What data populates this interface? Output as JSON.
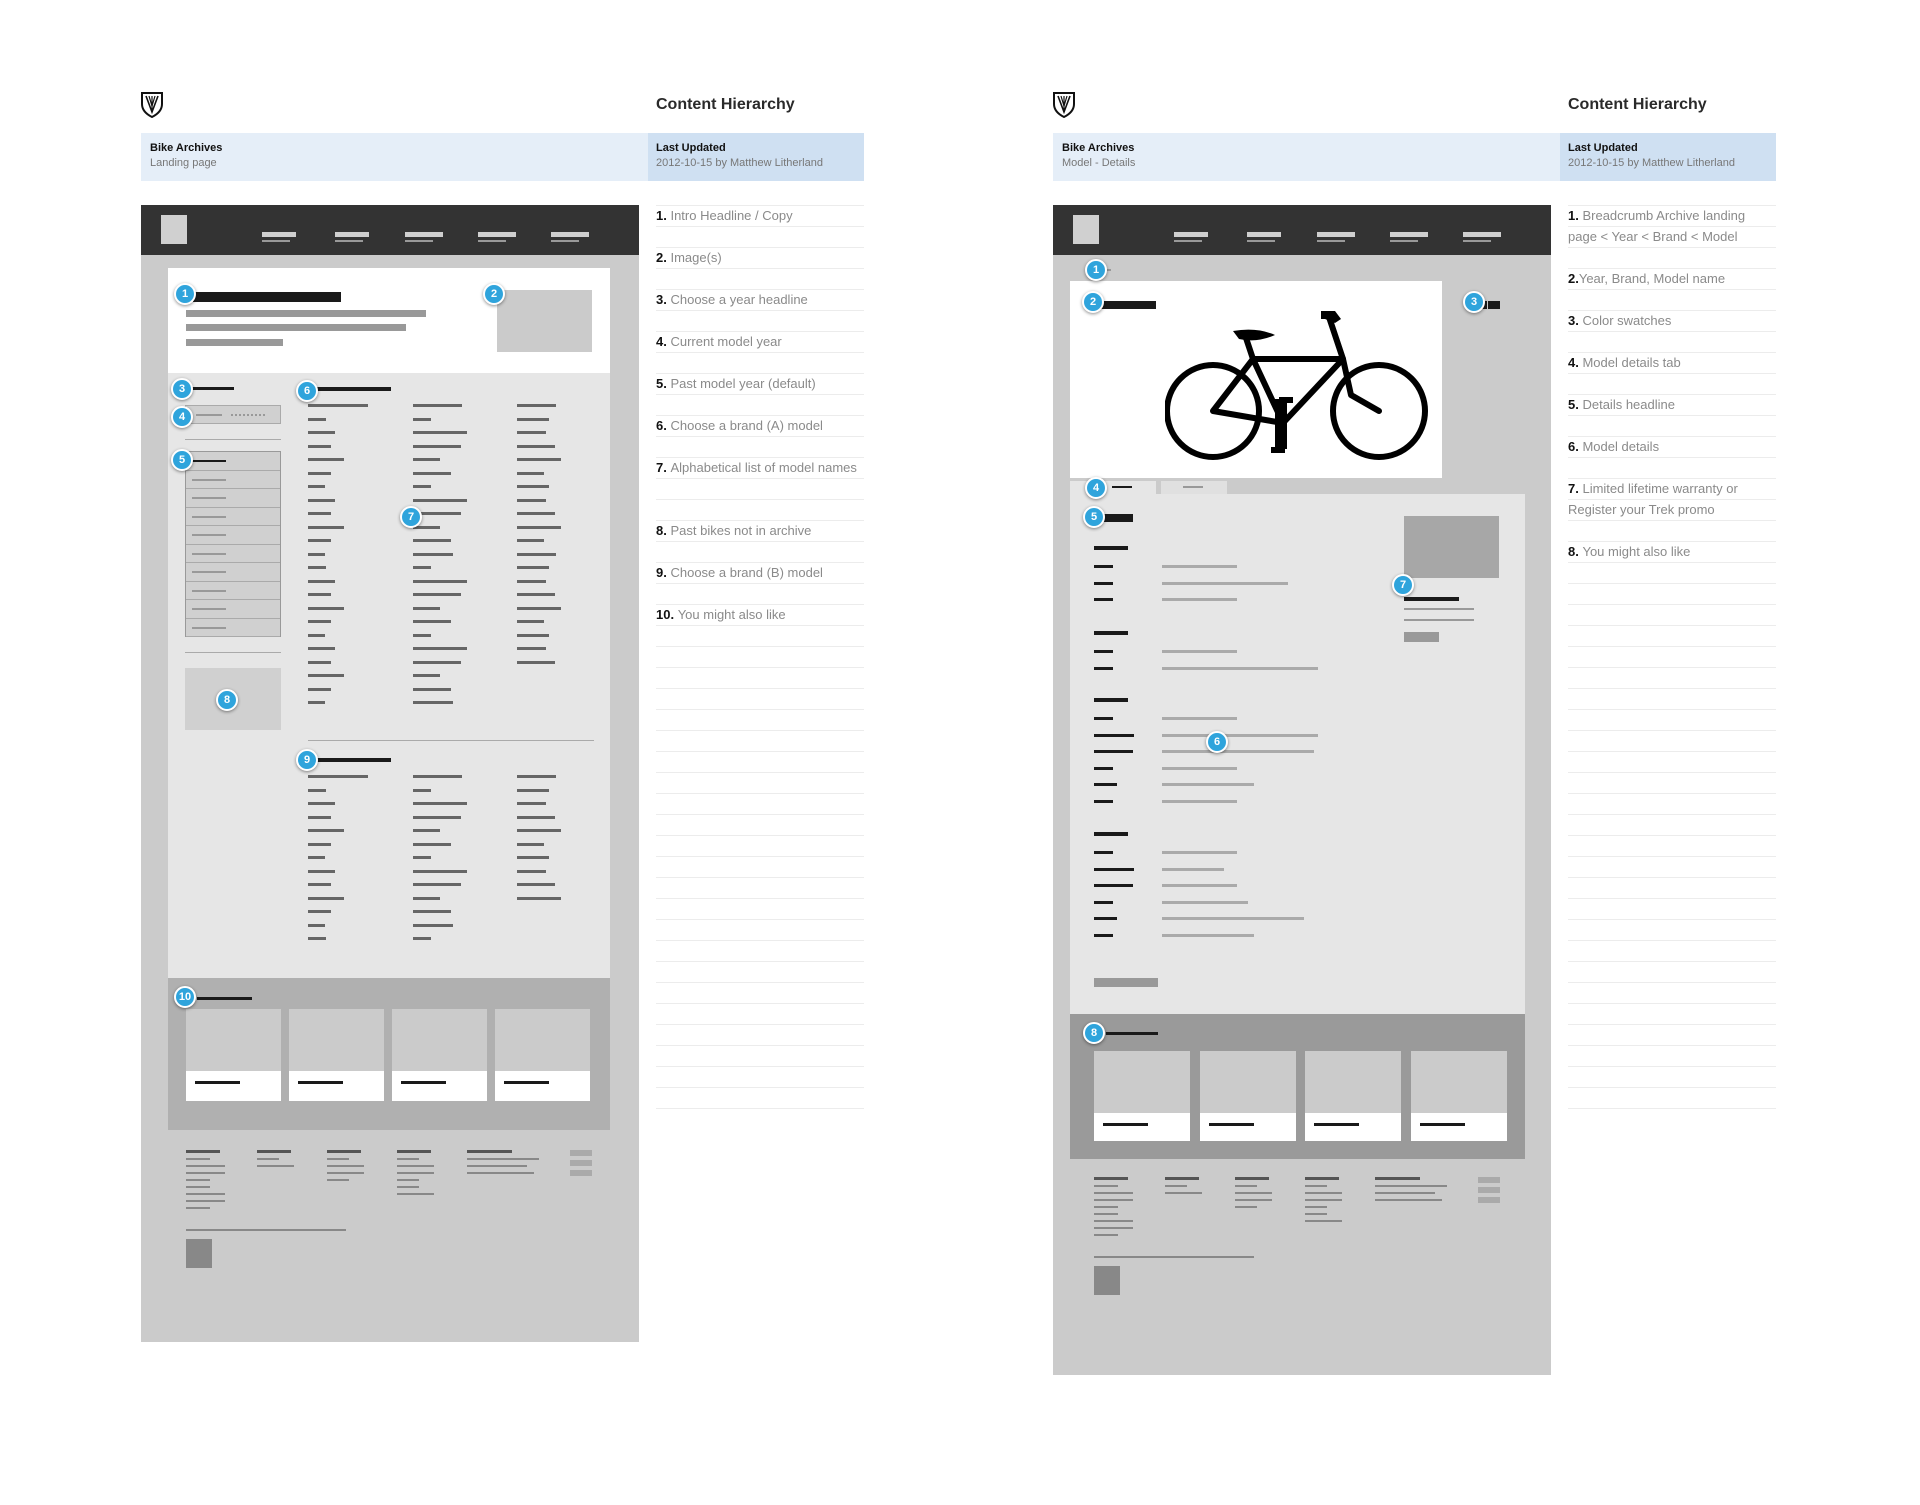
{
  "sheets": [
    {
      "id": "landing",
      "logo_icon": "trek-shield-logo-icon",
      "section_title": "Content Hierarchy",
      "project": "Bike Archives",
      "page_name": "Landing page",
      "updated_label": "Last Updated",
      "updated_value": "2012-10-15 by Matthew Litherland",
      "notes": [
        {
          "num": "1.",
          "text": "Intro Headline / Copy"
        },
        {
          "num": "2.",
          "text": "Image(s)"
        },
        {
          "num": "3.",
          "text": "Choose a year headline"
        },
        {
          "num": "4.",
          "text": "Current model year"
        },
        {
          "num": "5.",
          "text": "Past model year (default)"
        },
        {
          "num": "6.",
          "text": "Choose a brand (A) model"
        },
        {
          "num": "7.",
          "text": "Alphabetical list of model names"
        },
        {
          "num": "8.",
          "text": "Past bikes not in archive"
        },
        {
          "num": "9.",
          "text": "Choose a brand (B) model"
        },
        {
          "num": "10.",
          "text": "You might also like"
        }
      ],
      "badges": [
        "1",
        "2",
        "3",
        "4",
        "5",
        "6",
        "7",
        "8",
        "9",
        "10"
      ]
    },
    {
      "id": "model-details",
      "logo_icon": "trek-shield-logo-icon",
      "section_title": "Content Hierarchy",
      "project": "Bike Archives",
      "page_name": "Model - Details",
      "updated_label": "Last Updated",
      "updated_value": "2012-10-15 by Matthew Litherland",
      "notes": [
        {
          "num": "1.",
          "text": "Breadcrumb Archive landing page < Year < Brand < Model"
        },
        {
          "num": "2.",
          "text": "Year, Brand, Model name"
        },
        {
          "num": "3.",
          "text": "Color swatches"
        },
        {
          "num": "4.",
          "text": "Model details tab"
        },
        {
          "num": "5.",
          "text": "Details headline"
        },
        {
          "num": "6.",
          "text": "Model details"
        },
        {
          "num": "7.",
          "text": "Limited lifetime warranty or Register your Trek promo"
        },
        {
          "num": "8.",
          "text": "You might also like"
        }
      ],
      "badges": [
        "1",
        "2",
        "3",
        "4",
        "5",
        "6",
        "7",
        "8"
      ],
      "hero_icon": "bicycle-icon"
    }
  ],
  "colors": {
    "badge": "#2fa4dc",
    "meta_bar": "#e5eef8",
    "meta_highlight": "#cfe0f2",
    "nav": "#333333",
    "wireframe_bg": "#cbcbcb"
  }
}
